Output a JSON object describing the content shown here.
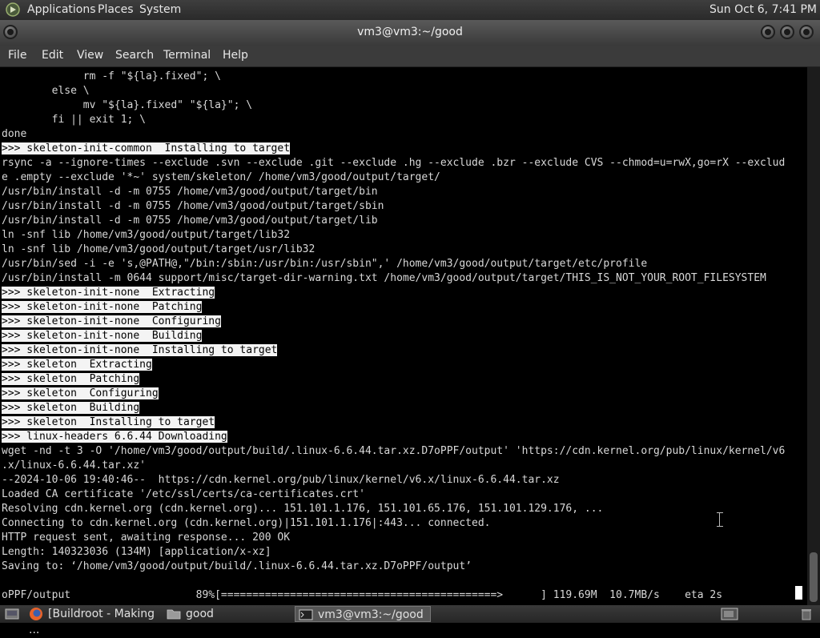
{
  "top_panel": {
    "menus": [
      "Applications",
      "Places",
      "System"
    ],
    "clock": "Sun Oct  6,  7:41 PM"
  },
  "window": {
    "title": "vm3@vm3:~/good"
  },
  "menubar": [
    "File",
    "Edit",
    "View",
    "Search",
    "Terminal",
    "Help"
  ],
  "terminal": {
    "lines": [
      {
        "text": "             rm -f \"${la}.fixed\"; \\",
        "hl": false
      },
      {
        "text": "        else \\",
        "hl": false
      },
      {
        "text": "             mv \"${la}.fixed\" \"${la}\"; \\",
        "hl": false
      },
      {
        "text": "        fi || exit 1; \\",
        "hl": false
      },
      {
        "text": "done",
        "hl": false
      },
      {
        "text": ">>> skeleton-init-common  Installing to target",
        "hl": true
      },
      {
        "text": "rsync -a --ignore-times --exclude .svn --exclude .git --exclude .hg --exclude .bzr --exclude CVS --chmod=u=rwX,go=rX --exclud",
        "hl": false
      },
      {
        "text": "e .empty --exclude '*~' system/skeleton/ /home/vm3/good/output/target/",
        "hl": false
      },
      {
        "text": "/usr/bin/install -d -m 0755 /home/vm3/good/output/target/bin",
        "hl": false
      },
      {
        "text": "/usr/bin/install -d -m 0755 /home/vm3/good/output/target/sbin",
        "hl": false
      },
      {
        "text": "/usr/bin/install -d -m 0755 /home/vm3/good/output/target/lib",
        "hl": false
      },
      {
        "text": "ln -snf lib /home/vm3/good/output/target/lib32",
        "hl": false
      },
      {
        "text": "ln -snf lib /home/vm3/good/output/target/usr/lib32",
        "hl": false
      },
      {
        "text": "/usr/bin/sed -i -e 's,@PATH@,\"/bin:/sbin:/usr/bin:/usr/sbin\",' /home/vm3/good/output/target/etc/profile",
        "hl": false
      },
      {
        "text": "/usr/bin/install -m 0644 support/misc/target-dir-warning.txt /home/vm3/good/output/target/THIS_IS_NOT_YOUR_ROOT_FILESYSTEM",
        "hl": false
      },
      {
        "text": ">>> skeleton-init-none  Extracting",
        "hl": true
      },
      {
        "text": ">>> skeleton-init-none  Patching",
        "hl": true
      },
      {
        "text": ">>> skeleton-init-none  Configuring",
        "hl": true
      },
      {
        "text": ">>> skeleton-init-none  Building",
        "hl": true
      },
      {
        "text": ">>> skeleton-init-none  Installing to target",
        "hl": true
      },
      {
        "text": ">>> skeleton  Extracting",
        "hl": true
      },
      {
        "text": ">>> skeleton  Patching",
        "hl": true
      },
      {
        "text": ">>> skeleton  Configuring",
        "hl": true
      },
      {
        "text": ">>> skeleton  Building",
        "hl": true
      },
      {
        "text": ">>> skeleton  Installing to target",
        "hl": true
      },
      {
        "text": ">>> linux-headers 6.6.44 Downloading",
        "hl": true
      },
      {
        "text": "wget -nd -t 3 -O '/home/vm3/good/output/build/.linux-6.6.44.tar.xz.D7oPPF/output' 'https://cdn.kernel.org/pub/linux/kernel/v6",
        "hl": false
      },
      {
        "text": ".x/linux-6.6.44.tar.xz'",
        "hl": false
      },
      {
        "text": "--2024-10-06 19:40:46--  https://cdn.kernel.org/pub/linux/kernel/v6.x/linux-6.6.44.tar.xz",
        "hl": false
      },
      {
        "text": "Loaded CA certificate '/etc/ssl/certs/ca-certificates.crt'",
        "hl": false
      },
      {
        "text": "Resolving cdn.kernel.org (cdn.kernel.org)... 151.101.1.176, 151.101.65.176, 151.101.129.176, ...",
        "hl": false
      },
      {
        "text": "Connecting to cdn.kernel.org (cdn.kernel.org)|151.101.1.176|:443... connected.",
        "hl": false
      },
      {
        "text": "HTTP request sent, awaiting response... 200 OK",
        "hl": false
      },
      {
        "text": "Length: 140323036 (134M) [application/x-xz]",
        "hl": false
      },
      {
        "text": "Saving to: ‘/home/vm3/good/output/build/.linux-6.6.44.tar.xz.D7oPPF/output’",
        "hl": false
      },
      {
        "text": "",
        "hl": false
      },
      {
        "text": "oPPF/output                    89%[============================================>      ] 119.69M  10.7MB/s    eta 2s",
        "hl": false
      }
    ]
  },
  "taskbar": {
    "tasks": [
      {
        "label": "[Buildroot - Making ...",
        "icon": "firefox-icon"
      },
      {
        "label": "good",
        "icon": "folder-icon"
      },
      {
        "label": "vm3@vm3:~/good",
        "icon": "terminal-icon"
      }
    ]
  },
  "colors": {
    "terminal_bg": "#000000",
    "terminal_fg": "#d8d8d8",
    "highlight_bg": "#f4f4f4"
  }
}
